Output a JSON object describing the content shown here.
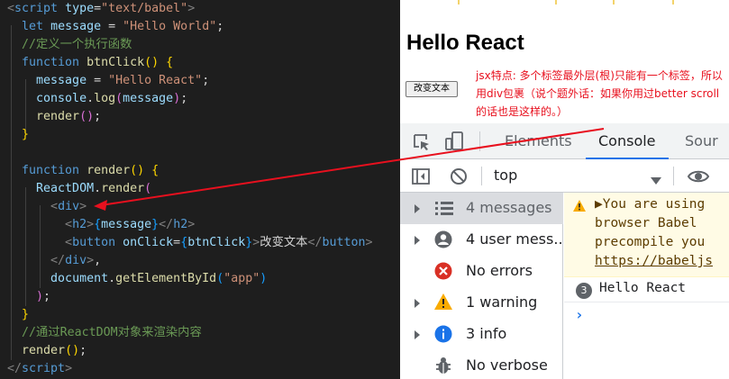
{
  "editor": {
    "lines": [
      [
        [
          "tk-brk",
          "<"
        ],
        [
          "tk-tag",
          "script"
        ],
        [
          "tk-plain",
          " "
        ],
        [
          "tk-attr",
          "type"
        ],
        [
          "tk-plain",
          "="
        ],
        [
          "tk-str",
          "\"text/babel\""
        ],
        [
          "tk-brk",
          ">"
        ]
      ],
      [
        [
          "tk-plain",
          "  "
        ],
        [
          "tk-kw",
          "let"
        ],
        [
          "tk-plain",
          " "
        ],
        [
          "tk-var",
          "message"
        ],
        [
          "tk-plain",
          " = "
        ],
        [
          "tk-str",
          "\"Hello World\""
        ],
        [
          "tk-plain",
          ";"
        ]
      ],
      [
        [
          "tk-plain",
          "  "
        ],
        [
          "tk-cmt",
          "//定义一个执行函数"
        ]
      ],
      [
        [
          "tk-plain",
          "  "
        ],
        [
          "tk-kw",
          "function"
        ],
        [
          "tk-plain",
          " "
        ],
        [
          "tk-fn",
          "btnClick"
        ],
        [
          "tk-p1",
          "()"
        ],
        [
          "tk-plain",
          " "
        ],
        [
          "tk-p1",
          "{"
        ]
      ],
      [
        [
          "tk-plain",
          "    "
        ],
        [
          "tk-var",
          "message"
        ],
        [
          "tk-plain",
          " = "
        ],
        [
          "tk-str",
          "\"Hello React\""
        ],
        [
          "tk-plain",
          ";"
        ]
      ],
      [
        [
          "tk-plain",
          "    "
        ],
        [
          "tk-var",
          "console"
        ],
        [
          "tk-plain",
          "."
        ],
        [
          "tk-fn",
          "log"
        ],
        [
          "tk-p2",
          "("
        ],
        [
          "tk-var",
          "message"
        ],
        [
          "tk-p2",
          ")"
        ],
        [
          "tk-plain",
          ";"
        ]
      ],
      [
        [
          "tk-plain",
          "    "
        ],
        [
          "tk-fn",
          "render"
        ],
        [
          "tk-p2",
          "()"
        ],
        [
          "tk-plain",
          ";"
        ]
      ],
      [
        [
          "tk-plain",
          "  "
        ],
        [
          "tk-p1",
          "}"
        ]
      ],
      [
        [
          "tk-plain",
          ""
        ]
      ],
      [
        [
          "tk-plain",
          "  "
        ],
        [
          "tk-kw",
          "function"
        ],
        [
          "tk-plain",
          " "
        ],
        [
          "tk-fn",
          "render"
        ],
        [
          "tk-p1",
          "()"
        ],
        [
          "tk-plain",
          " "
        ],
        [
          "tk-p1",
          "{"
        ]
      ],
      [
        [
          "tk-plain",
          "    "
        ],
        [
          "tk-var",
          "ReactDOM"
        ],
        [
          "tk-plain",
          "."
        ],
        [
          "tk-fn",
          "render"
        ],
        [
          "tk-p2",
          "("
        ]
      ],
      [
        [
          "tk-plain",
          "      "
        ],
        [
          "tk-brk",
          "<"
        ],
        [
          "tk-tag",
          "div"
        ],
        [
          "tk-brk",
          ">"
        ]
      ],
      [
        [
          "tk-plain",
          "        "
        ],
        [
          "tk-brk",
          "<"
        ],
        [
          "tk-tag",
          "h2"
        ],
        [
          "tk-brk",
          ">"
        ],
        [
          "tk-p3",
          "{"
        ],
        [
          "tk-var",
          "message"
        ],
        [
          "tk-p3",
          "}"
        ],
        [
          "tk-brk",
          "</"
        ],
        [
          "tk-tag",
          "h2"
        ],
        [
          "tk-brk",
          ">"
        ]
      ],
      [
        [
          "tk-plain",
          "        "
        ],
        [
          "tk-brk",
          "<"
        ],
        [
          "tk-tag",
          "button"
        ],
        [
          "tk-plain",
          " "
        ],
        [
          "tk-attr",
          "onClick"
        ],
        [
          "tk-plain",
          "="
        ],
        [
          "tk-p3",
          "{"
        ],
        [
          "tk-var",
          "btnClick"
        ],
        [
          "tk-p3",
          "}"
        ],
        [
          "tk-brk",
          ">"
        ],
        [
          "tk-plain",
          "改变文本"
        ],
        [
          "tk-brk",
          "</"
        ],
        [
          "tk-tag",
          "button"
        ],
        [
          "tk-brk",
          ">"
        ]
      ],
      [
        [
          "tk-plain",
          "      "
        ],
        [
          "tk-brk",
          "</"
        ],
        [
          "tk-tag",
          "div"
        ],
        [
          "tk-brk",
          ">"
        ],
        [
          "tk-plain",
          ","
        ]
      ],
      [
        [
          "tk-plain",
          "      "
        ],
        [
          "tk-var",
          "document"
        ],
        [
          "tk-plain",
          "."
        ],
        [
          "tk-fn",
          "getElementById"
        ],
        [
          "tk-p3",
          "("
        ],
        [
          "tk-str",
          "\"app\""
        ],
        [
          "tk-p3",
          ")"
        ]
      ],
      [
        [
          "tk-plain",
          "    "
        ],
        [
          "tk-p2",
          ")"
        ],
        [
          "tk-plain",
          ";"
        ]
      ],
      [
        [
          "tk-plain",
          "  "
        ],
        [
          "tk-p1",
          "}"
        ]
      ],
      [
        [
          "tk-plain",
          "  "
        ],
        [
          "tk-cmt",
          "//通过ReactDOM对象来渲染内容"
        ]
      ],
      [
        [
          "tk-plain",
          "  "
        ],
        [
          "tk-fn",
          "render"
        ],
        [
          "tk-p1",
          "()"
        ],
        [
          "tk-plain",
          ";"
        ]
      ],
      [
        [
          "tk-brk",
          "</"
        ],
        [
          "tk-tag",
          "script"
        ],
        [
          "tk-brk",
          ">"
        ]
      ]
    ]
  },
  "page": {
    "heading": "Hello React",
    "button_label": "改变文本",
    "annotation": "jsx特点: 多个标签最外层(根)只能有一个标签，所以用div包裹（说个题外话：如果你用过better scroll的话也是这样的。）"
  },
  "devtools": {
    "tabs": [
      {
        "label": "Elements",
        "active": false
      },
      {
        "label": "Console",
        "active": true
      },
      {
        "label": "Sour",
        "active": false
      }
    ],
    "context_select": "top",
    "sidebar": [
      {
        "label": "4 messages",
        "icon": "list-icon",
        "selected": true
      },
      {
        "label": "4 user mess...",
        "icon": "user-icon",
        "selected": false
      },
      {
        "label": "No errors",
        "icon": "error-icon",
        "selected": false
      },
      {
        "label": "1 warning",
        "icon": "warning-icon",
        "selected": false
      },
      {
        "label": "3 info",
        "icon": "info-icon",
        "selected": false
      },
      {
        "label": "No verbose",
        "icon": "bug-icon",
        "selected": false
      }
    ],
    "console": {
      "warning_lines": [
        "▶You are using",
        "browser Babel",
        "precompile you",
        "https://babeljs"
      ],
      "log_count": "3",
      "log_message": "Hello React",
      "prompt": "›"
    }
  },
  "colors": {
    "editor_bg": "#1e1e1e",
    "annotation_red": "#e8101e",
    "devtools_accent": "#1a73e8",
    "warning_bg": "#fffbe5"
  }
}
